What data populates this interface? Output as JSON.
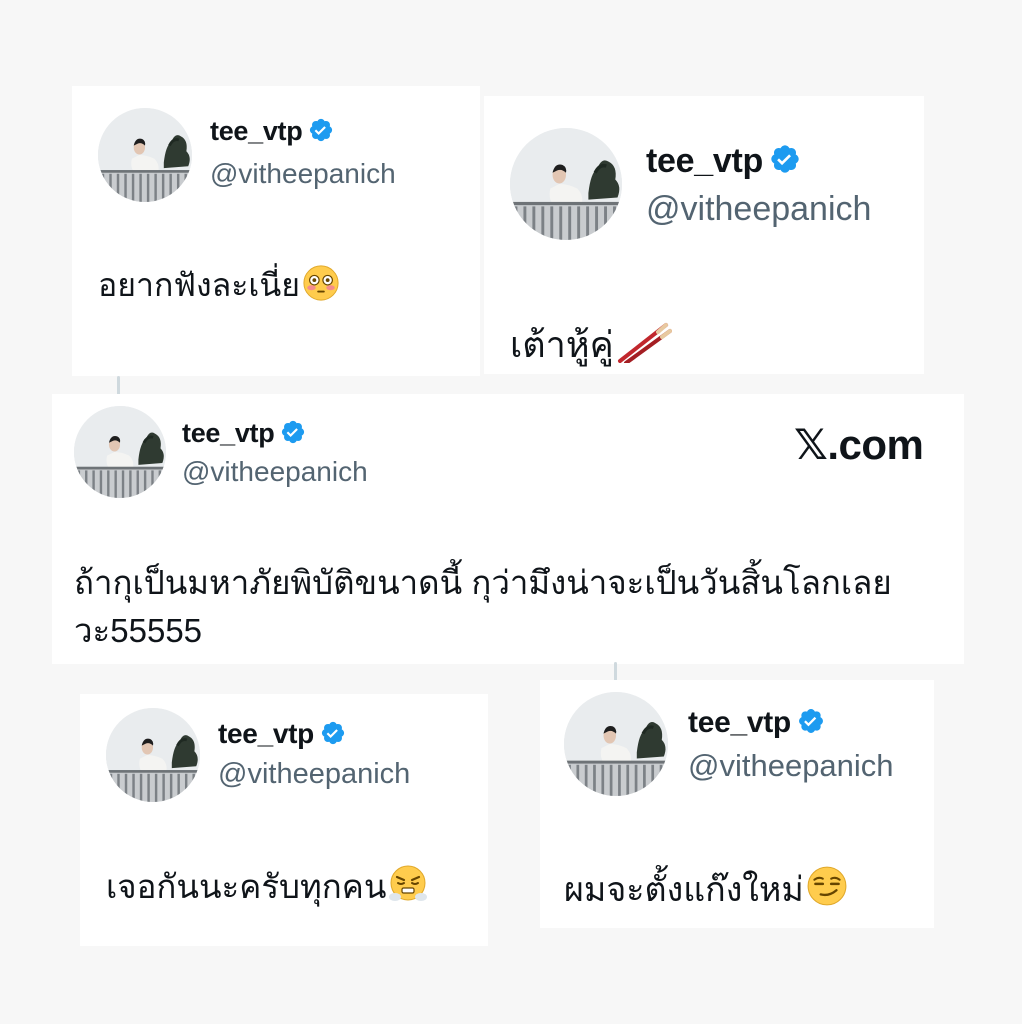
{
  "profile": {
    "display_name": "tee_vtp",
    "handle": "@vitheepanich",
    "verified_icon": "verified-badge-icon",
    "badge_color": "#1d9bf0"
  },
  "brand": {
    "text": "𝕏.com"
  },
  "posts": [
    {
      "text": "อยากฟังละเนี่ย",
      "emoji": "flushed-face-icon"
    },
    {
      "text": "เต้าหู้คู่",
      "emoji": "chopsticks-icon"
    },
    {
      "line1": "ถ้ากุเป็นมหาภัยพิบัติขนาดนี้ กุว่ามึงน่าจะเป็นวันสิ้นโลกเลย",
      "line2": "วะ55555"
    },
    {
      "text": "เจอกันนะครับทุกคน",
      "emoji": "face-with-steam-icon"
    },
    {
      "text": "ผมจะตั้งแก๊งใหม่",
      "emoji": "smirking-face-icon"
    }
  ]
}
